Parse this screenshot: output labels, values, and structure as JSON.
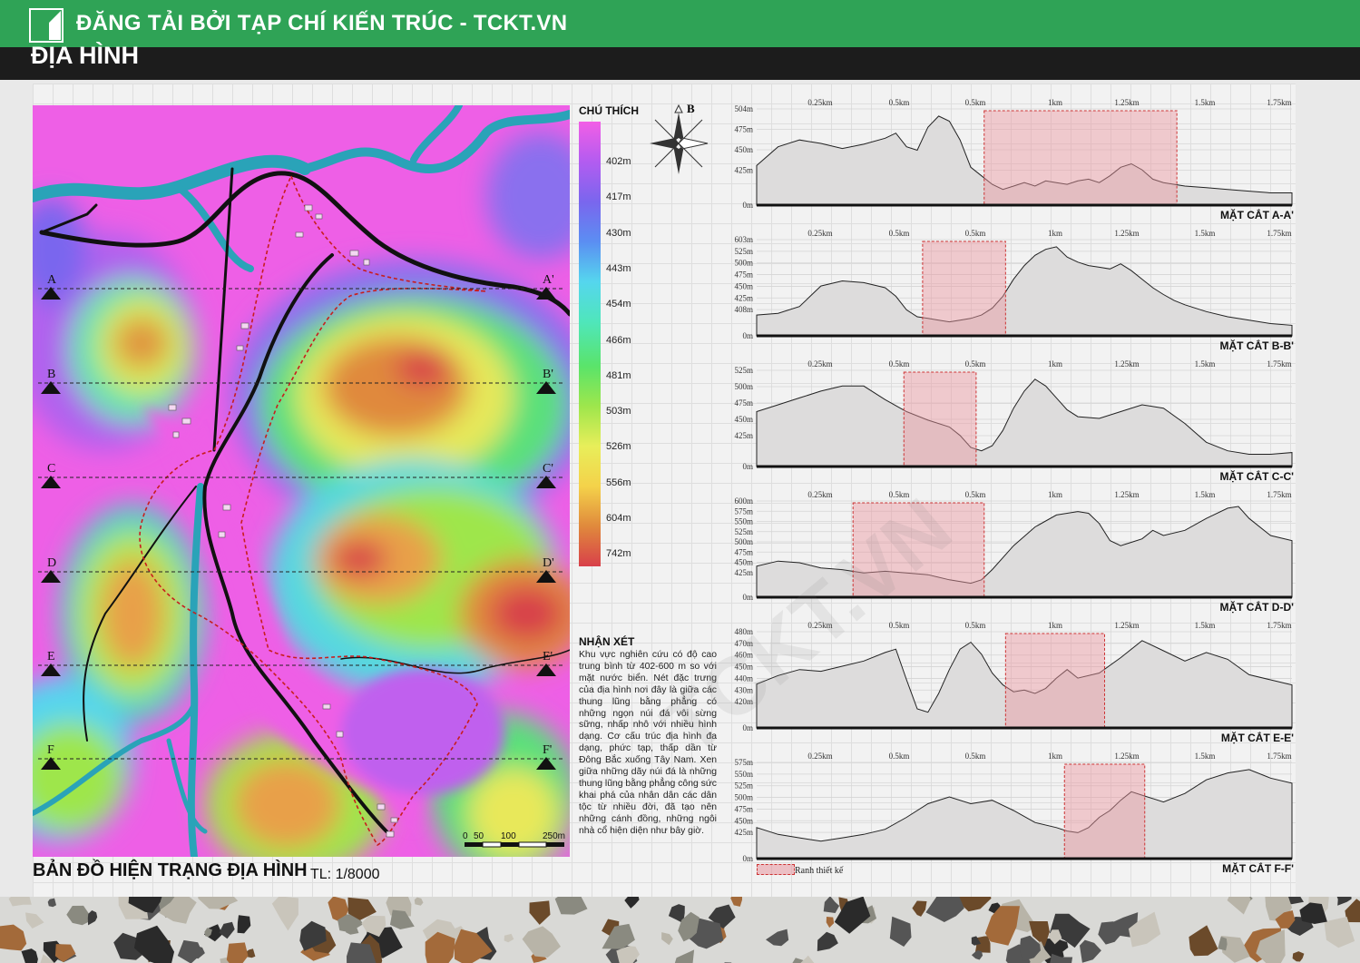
{
  "banner": {
    "text": "ĐĂNG TẢI BỞI TẠP CHÍ KIẾN TRÚC - TCKT.VN",
    "color": "#2fa356"
  },
  "page_title": "ĐỊA HÌNH",
  "map": {
    "caption": "BẢN ĐỒ HIỆN TRẠNG ĐỊA HÌNH",
    "scale_ratio": "TL: 1/8000",
    "scale_labels": [
      "0",
      "50",
      "100",
      "250m"
    ],
    "section_markers": [
      {
        "left": "A",
        "right": "A'"
      },
      {
        "left": "B",
        "right": "B'"
      },
      {
        "left": "C",
        "right": "C'"
      },
      {
        "left": "D",
        "right": "D'"
      },
      {
        "left": "E",
        "right": "E'"
      },
      {
        "left": "F",
        "right": "F'"
      }
    ]
  },
  "legend": {
    "title": "CHÚ THÍCH",
    "north": "B",
    "levels": [
      "402m",
      "417m",
      "430m",
      "443m",
      "454m",
      "466m",
      "481m",
      "503m",
      "526m",
      "556m",
      "604m",
      "742m"
    ],
    "colors": [
      "#f25ee6",
      "#b35cf0",
      "#7a66ee",
      "#5b8ef2",
      "#55d6ee",
      "#4fe6bb",
      "#5ae46a",
      "#9ee64c",
      "#e8ee5a",
      "#f4d24a",
      "#e0893c",
      "#d8404a"
    ]
  },
  "comment": {
    "title": "NHẬN XÉT",
    "body": "Khu vực nghiên cứu có độ cao trung bình từ 402-600 m so với mặt nước biển. Nét đặc trưng của địa hình nơi đây là giữa các thung lũng bằng phẳng có những ngọn núi đá vôi sừng sững, nhấp nhô với nhiều hình dạng. Cơ cấu trúc địa hình đa dạng, phức tạp, thấp dần từ Đông Bắc xuống Tây Nam. Xen giữa những dãy núi đá là những thung lũng bằng phẳng công sức khai phá của nhân dân các dân tộc từ nhiều đời, đã tạo nên những cánh đồng, những ngôi nhà cổ hiện diện như bây giờ."
  },
  "boundary_legend": "Ranh thiết kế",
  "watermark": "TCKT.VN",
  "chart_data": [
    {
      "type": "area",
      "title": "MẶT CẮT A-A'",
      "x_ticks": [
        "0.25km",
        "0.5km",
        "0.5km",
        "1km",
        "1.25km",
        "1.5km",
        "1.75km"
      ],
      "y_ticks": [
        "504m",
        "475m",
        "450m",
        "425m",
        "0m"
      ],
      "x": [
        0,
        0.04,
        0.08,
        0.12,
        0.16,
        0.2,
        0.24,
        0.26,
        0.28,
        0.3,
        0.32,
        0.34,
        0.36,
        0.38,
        0.4,
        0.42,
        0.44,
        0.46,
        0.48,
        0.5,
        0.52,
        0.54,
        0.56,
        0.58,
        0.6,
        0.62,
        0.64,
        0.66,
        0.68,
        0.7,
        0.72,
        0.74,
        0.76,
        0.78,
        0.8,
        0.84,
        0.88,
        0.92,
        0.96,
        1
      ],
      "y": [
        0.4,
        0.62,
        0.7,
        0.66,
        0.6,
        0.65,
        0.72,
        0.78,
        0.62,
        0.58,
        0.85,
        0.98,
        0.92,
        0.7,
        0.38,
        0.28,
        0.18,
        0.12,
        0.16,
        0.2,
        0.16,
        0.22,
        0.2,
        0.18,
        0.22,
        0.24,
        0.2,
        0.28,
        0.38,
        0.42,
        0.35,
        0.24,
        0.2,
        0.18,
        0.16,
        0.14,
        0.12,
        0.1,
        0.08,
        0.08
      ],
      "boundary": [
        0.425,
        0.785
      ]
    },
    {
      "type": "area",
      "title": "MẶT CẮT B-B'",
      "x_ticks": [
        "0.25km",
        "0.5km",
        "0.5km",
        "1km",
        "1.25km",
        "1.5km",
        "1.75km"
      ],
      "y_ticks": [
        "603m",
        "525m",
        "500m",
        "475m",
        "450m",
        "425m",
        "408m",
        "0m"
      ],
      "x": [
        0,
        0.04,
        0.08,
        0.1,
        0.12,
        0.16,
        0.2,
        0.24,
        0.26,
        0.28,
        0.3,
        0.32,
        0.34,
        0.36,
        0.38,
        0.4,
        0.42,
        0.44,
        0.46,
        0.48,
        0.5,
        0.52,
        0.54,
        0.56,
        0.58,
        0.6,
        0.62,
        0.64,
        0.66,
        0.68,
        0.7,
        0.72,
        0.74,
        0.76,
        0.78,
        0.8,
        0.84,
        0.88,
        0.92,
        0.96,
        1
      ],
      "y": [
        0.18,
        0.2,
        0.28,
        0.4,
        0.52,
        0.58,
        0.56,
        0.5,
        0.4,
        0.24,
        0.16,
        0.14,
        0.12,
        0.1,
        0.12,
        0.14,
        0.18,
        0.26,
        0.4,
        0.6,
        0.76,
        0.88,
        0.95,
        0.98,
        0.86,
        0.8,
        0.76,
        0.74,
        0.72,
        0.78,
        0.7,
        0.6,
        0.5,
        0.42,
        0.35,
        0.3,
        0.22,
        0.16,
        0.12,
        0.08,
        0.06
      ],
      "boundary": [
        0.31,
        0.465
      ]
    },
    {
      "type": "area",
      "title": "MẶT CẮT C-C'",
      "x_ticks": [
        "0.25km",
        "0.5km",
        "0.5km",
        "1km",
        "1.25km",
        "1.5km",
        "1.75km"
      ],
      "y_ticks": [
        "525m",
        "500m",
        "475m",
        "450m",
        "425m",
        "0m"
      ],
      "x": [
        0,
        0.04,
        0.08,
        0.12,
        0.16,
        0.2,
        0.24,
        0.28,
        0.32,
        0.36,
        0.38,
        0.4,
        0.42,
        0.44,
        0.46,
        0.48,
        0.5,
        0.52,
        0.54,
        0.56,
        0.58,
        0.6,
        0.64,
        0.68,
        0.72,
        0.76,
        0.8,
        0.84,
        0.88,
        0.92,
        0.96,
        1
      ],
      "y": [
        0.58,
        0.66,
        0.74,
        0.82,
        0.88,
        0.88,
        0.72,
        0.58,
        0.48,
        0.4,
        0.3,
        0.16,
        0.12,
        0.18,
        0.36,
        0.62,
        0.82,
        0.96,
        0.88,
        0.74,
        0.6,
        0.52,
        0.5,
        0.58,
        0.66,
        0.62,
        0.44,
        0.22,
        0.12,
        0.08,
        0.08,
        0.1
      ],
      "boundary": [
        0.275,
        0.41
      ]
    },
    {
      "type": "area",
      "title": "MẶT CẮT D-D'",
      "x_ticks": [
        "0.25km",
        "0.5km",
        "0.5km",
        "1km",
        "1.25km",
        "1.5km",
        "1.75km"
      ],
      "y_ticks": [
        "600m",
        "575m",
        "550m",
        "525m",
        "500m",
        "475m",
        "450m",
        "425m",
        "0m"
      ],
      "x": [
        0,
        0.04,
        0.08,
        0.12,
        0.16,
        0.2,
        0.24,
        0.28,
        0.32,
        0.36,
        0.4,
        0.42,
        0.44,
        0.48,
        0.52,
        0.56,
        0.6,
        0.62,
        0.64,
        0.66,
        0.68,
        0.7,
        0.72,
        0.74,
        0.76,
        0.8,
        0.84,
        0.88,
        0.9,
        0.92,
        0.96,
        1
      ],
      "y": [
        0.3,
        0.36,
        0.34,
        0.28,
        0.26,
        0.22,
        0.24,
        0.22,
        0.2,
        0.14,
        0.1,
        0.14,
        0.26,
        0.54,
        0.76,
        0.9,
        0.94,
        0.92,
        0.8,
        0.6,
        0.54,
        0.58,
        0.62,
        0.72,
        0.66,
        0.72,
        0.86,
        0.98,
        1.0,
        0.86,
        0.66,
        0.6
      ],
      "boundary": [
        0.18,
        0.425
      ]
    },
    {
      "type": "area",
      "title": "MẶT CẮT E-E'",
      "x_ticks": [
        "0.25km",
        "0.5km",
        "0.5km",
        "1km",
        "1.25km",
        "1.5km",
        "1.75km"
      ],
      "y_ticks": [
        "480m",
        "470m",
        "460m",
        "450m",
        "440m",
        "430m",
        "420m",
        "0m"
      ],
      "x": [
        0,
        0.04,
        0.08,
        0.12,
        0.16,
        0.2,
        0.24,
        0.26,
        0.28,
        0.3,
        0.32,
        0.34,
        0.36,
        0.38,
        0.4,
        0.42,
        0.44,
        0.46,
        0.48,
        0.5,
        0.52,
        0.54,
        0.56,
        0.58,
        0.6,
        0.64,
        0.68,
        0.72,
        0.76,
        0.8,
        0.84,
        0.88,
        0.92,
        0.96,
        1
      ],
      "y": [
        0.45,
        0.55,
        0.62,
        0.6,
        0.66,
        0.72,
        0.82,
        0.86,
        0.5,
        0.16,
        0.12,
        0.34,
        0.62,
        0.86,
        0.94,
        0.8,
        0.58,
        0.44,
        0.36,
        0.38,
        0.34,
        0.4,
        0.52,
        0.62,
        0.52,
        0.58,
        0.76,
        0.96,
        0.84,
        0.72,
        0.82,
        0.74,
        0.56,
        0.5,
        0.44
      ],
      "boundary": [
        0.465,
        0.65
      ]
    },
    {
      "type": "area",
      "title": "MẶT CẮT F-F'",
      "x_ticks": [
        "0.25km",
        "0.5km",
        "0.5km",
        "1km",
        "1.25km",
        "1.5km",
        "1.75km"
      ],
      "y_ticks": [
        "575m",
        "550m",
        "525m",
        "500m",
        "475m",
        "450m",
        "425m",
        "0m"
      ],
      "x": [
        0,
        0.04,
        0.08,
        0.12,
        0.16,
        0.2,
        0.24,
        0.28,
        0.32,
        0.36,
        0.4,
        0.44,
        0.48,
        0.52,
        0.56,
        0.58,
        0.6,
        0.62,
        0.64,
        0.66,
        0.68,
        0.7,
        0.72,
        0.76,
        0.8,
        0.84,
        0.88,
        0.92,
        0.96,
        1
      ],
      "y": [
        0.3,
        0.22,
        0.18,
        0.14,
        0.18,
        0.22,
        0.28,
        0.42,
        0.58,
        0.66,
        0.58,
        0.62,
        0.5,
        0.36,
        0.3,
        0.26,
        0.24,
        0.3,
        0.42,
        0.5,
        0.62,
        0.72,
        0.68,
        0.6,
        0.7,
        0.86,
        0.94,
        0.98,
        0.88,
        0.82
      ],
      "boundary": [
        0.575,
        0.725
      ]
    }
  ]
}
